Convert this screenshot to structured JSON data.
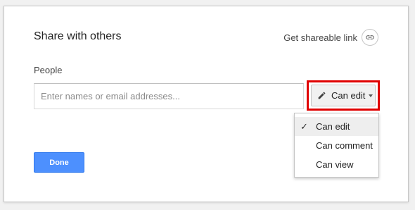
{
  "dialog": {
    "title": "Share with others",
    "shareable_link_label": "Get shareable link",
    "people_label": "People",
    "people_input": {
      "value": "",
      "placeholder": "Enter names or email addresses..."
    },
    "permission_button_label": "Can edit",
    "permission_menu": [
      {
        "label": "Can edit",
        "selected": true
      },
      {
        "label": "Can comment",
        "selected": false
      },
      {
        "label": "Can view",
        "selected": false
      }
    ],
    "check_glyph": "✓",
    "done_label": "Done"
  },
  "icons": {
    "link": "link-icon",
    "pencil": "pencil-icon",
    "caret": "chevron-down-icon",
    "check": "check-icon"
  },
  "colors": {
    "primary_button": "#4d90fe",
    "highlight_box": "#e00000"
  }
}
